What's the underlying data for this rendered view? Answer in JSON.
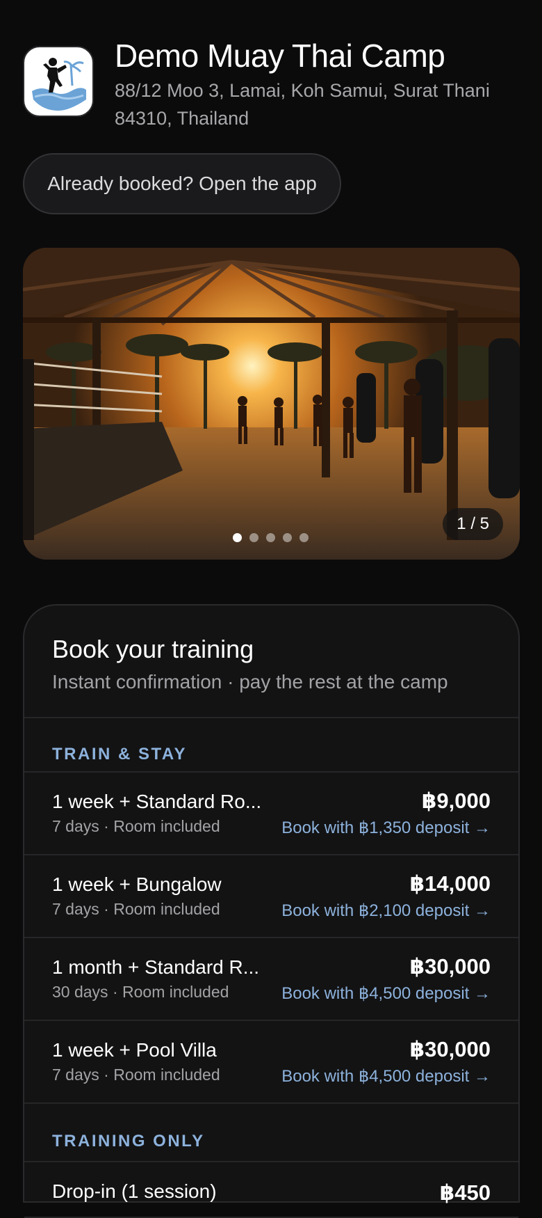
{
  "camp": {
    "name": "Demo Muay Thai Camp",
    "address": "88/12 Moo 3, Lamai, Koh Samui, Surat Thani 84310, Thailand",
    "logo_icon": "muay-thai-fighter-palm-logo"
  },
  "open_app_label": "Already booked? Open the app",
  "gallery": {
    "counter": "1 / 5",
    "total": 5,
    "active_index": 0
  },
  "booking": {
    "title": "Book your training",
    "subtitle": "Instant confirmation · pay the rest at the camp",
    "sections": [
      {
        "label": "TRAIN & STAY",
        "packages": [
          {
            "name": "1 week + Standard Ro...",
            "meta": "7 days · Room included",
            "price": "฿9,000",
            "deposit": "Book with ฿1,350 deposit →"
          },
          {
            "name": "1 week + Bungalow",
            "meta": "7 days · Room included",
            "price": "฿14,000",
            "deposit": "Book with ฿2,100 deposit →"
          },
          {
            "name": "1 month + Standard R...",
            "meta": "30 days · Room included",
            "price": "฿30,000",
            "deposit": "Book with ฿4,500 deposit →"
          },
          {
            "name": "1 week + Pool Villa",
            "meta": "7 days · Room included",
            "price": "฿30,000",
            "deposit": "Book with ฿4,500 deposit →"
          }
        ]
      },
      {
        "label": "TRAINING ONLY",
        "packages": [
          {
            "name": "Drop-in (1 session)",
            "meta": "",
            "price": "฿450",
            "deposit": ""
          }
        ]
      }
    ]
  },
  "colors": {
    "background": "#0b0b0c",
    "card": "#131314",
    "accent": "#8db2dc"
  }
}
